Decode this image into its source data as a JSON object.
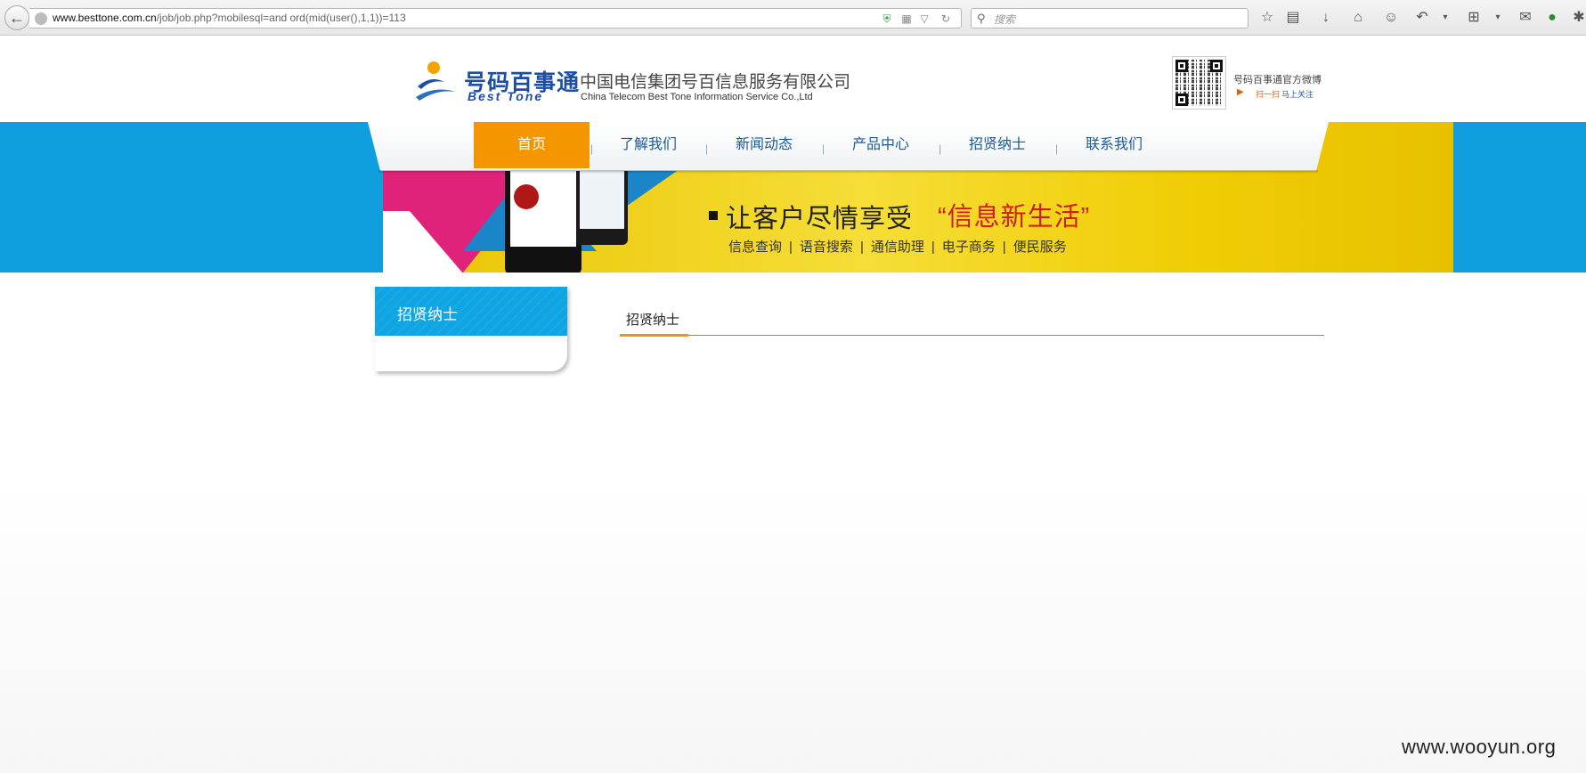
{
  "browser": {
    "url_domain": "www.besttone.com.cn",
    "url_path": "/job/job.php?mobilesql=and ord(mid(user(),1,1))=113",
    "search_placeholder": "搜索"
  },
  "header": {
    "logo_cn": "号码百事通",
    "logo_en": "Best Tone",
    "company_cn": "中国电信集团号百信息服务有限公司",
    "company_en": "China Telecom Best Tone Information Service Co.,Ltd",
    "weibo_title": "号码百事通官方微博",
    "weibo_scan": "扫一扫",
    "weibo_follow": "马上关注"
  },
  "nav": {
    "items": [
      "首页",
      "了解我们",
      "新闻动态",
      "产品中心",
      "招贤纳士",
      "联系我们"
    ],
    "active": "首页"
  },
  "banner": {
    "slogan": "让客户尽情享受",
    "slogan_quote": "“信息新生活”",
    "services": [
      "信息查询",
      "语音搜索",
      "通信助理",
      "电子商务",
      "便民服务"
    ]
  },
  "sidebar": {
    "title": "招贤纳士"
  },
  "content": {
    "title": "招贤纳士"
  },
  "watermark": "www.wooyun.org",
  "colors": {
    "accent_orange": "#f39600",
    "banner_blue": "#0f9fde",
    "nav_text": "#1b5a9a"
  }
}
